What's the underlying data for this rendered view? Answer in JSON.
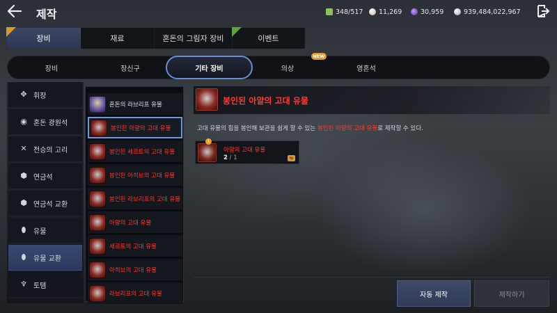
{
  "header": {
    "title": "제작",
    "currencies": [
      {
        "icon": "stamina-icon",
        "value": "348/517",
        "color": "#8fc25a"
      },
      {
        "icon": "silver-icon",
        "value": "11,269",
        "color": "#d8c8c8"
      },
      {
        "icon": "dark-energy-icon",
        "value": "30,959",
        "color": "#8a4fd0"
      },
      {
        "icon": "coin-icon",
        "value": "939,484,022,967",
        "color": "#dfe3ea"
      }
    ]
  },
  "main_tabs": [
    {
      "label": "장비",
      "active": true,
      "badge": "corner-orange"
    },
    {
      "label": "재료",
      "active": false,
      "badge": ""
    },
    {
      "label": "혼돈의 그림자 장비",
      "active": false,
      "badge": ""
    },
    {
      "label": "이벤트",
      "active": false,
      "badge": "corner-green"
    }
  ],
  "sub_tabs": [
    {
      "label": "장비"
    },
    {
      "label": "장신구"
    },
    {
      "label": "기타 장비",
      "active": true
    },
    {
      "label": "의상"
    },
    {
      "label": "영혼석"
    }
  ],
  "new_badge": "NEW",
  "categories": [
    {
      "label": "휘장",
      "icon": "emblem-icon",
      "glyph": "✥"
    },
    {
      "label": "혼돈 광원석",
      "icon": "chaos-stone-icon",
      "glyph": "◉"
    },
    {
      "label": "전승의 고리",
      "icon": "ring-icon",
      "glyph": "✕"
    },
    {
      "label": "연금석",
      "icon": "alchemy-stone-icon",
      "glyph": "⬢"
    },
    {
      "label": "연금석 교환",
      "icon": "alchemy-exchange-icon",
      "glyph": "⬢"
    },
    {
      "label": "유물",
      "icon": "relic-icon",
      "glyph": "⬮"
    },
    {
      "label": "유물 교환",
      "icon": "relic-exchange-icon",
      "glyph": "⬮",
      "active": true
    },
    {
      "label": "토템",
      "icon": "totem-icon",
      "glyph": "♆"
    }
  ],
  "relics": [
    {
      "label": "혼돈의 라브리프 유물",
      "color": "#dfe3ea",
      "icon_color": "#6b5aa8"
    },
    {
      "label": "봉인된 아얄의 고대 유물",
      "color": "#ff3a32",
      "icon_color": "#8b2a22",
      "active": true
    },
    {
      "label": "봉인된 세르트의 고대 유물",
      "color": "#ff3a32",
      "icon_color": "#3f5a8a"
    },
    {
      "label": "봉인된 아히브의 고대 유물",
      "color": "#ff3a32",
      "icon_color": "#3c6b6a"
    },
    {
      "label": "봉인된 라브리프의 고대 유물",
      "color": "#ff3a32",
      "icon_color": "#6a6a3a"
    },
    {
      "label": "아얄의 고대 유물",
      "color": "#ff3a32",
      "icon_color": "#8b2a22"
    },
    {
      "label": "세르트의 고대 유물",
      "color": "#ff3a32",
      "icon_color": "#3f5a8a"
    },
    {
      "label": "아히브의 고대 유물",
      "color": "#ff3a32",
      "icon_color": "#3c6b6a"
    },
    {
      "label": "라브리프의 고대 유물",
      "color": "#ff3a32",
      "icon_color": "#6a6a3a"
    }
  ],
  "detail": {
    "title": "봉인된 아얄의 고대 유물",
    "desc_before": "고대 유물의 힘을 봉인해 보관을 쉽게 할 수 있는 ",
    "desc_highlight": "봉인된 아얄의 고대 유물",
    "desc_after": "로 제작할 수 있다.",
    "material": {
      "name": "아얄의 고대 유물",
      "owned": "2",
      "separator": " / ",
      "required": "1",
      "alert": "!"
    }
  },
  "buttons": {
    "auto_craft": "자동 제작",
    "craft": "제작하기"
  },
  "colors": {
    "accent": "#6a8fd6",
    "highlight_red": "#ff3a32",
    "badge_orange": "#e39a29"
  }
}
